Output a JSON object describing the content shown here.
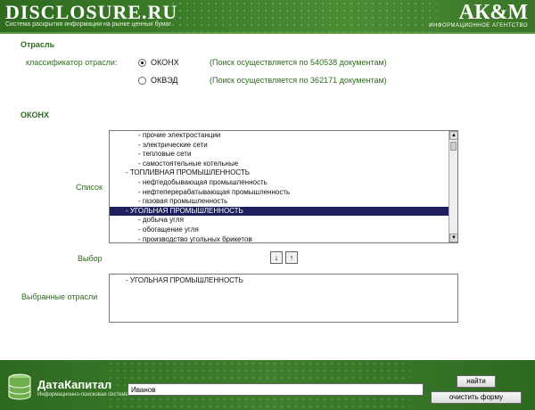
{
  "header": {
    "site_title": "DISCLOSURE.RU",
    "site_subtitle": "Система раскрытия информации на рынке ценных бумаг",
    "brand": "АК&М",
    "brand_subtitle": "ИНФОРМАЦИОННОЕ АГЕНТСТВО"
  },
  "section_industry": "Отрасль",
  "classifier": {
    "label": "классификатор отрасли:",
    "options": [
      {
        "label": "ОКОНХ",
        "checked": true,
        "note": "(Поиск осуществляется по 540538 документам)"
      },
      {
        "label": "ОКВЭД",
        "checked": false,
        "note": "(Поиск осуществляется по 362171 документам)"
      }
    ]
  },
  "section_okonh": "ОКОНХ",
  "list": {
    "label": "Список",
    "items": [
      "- прочие электростанции",
      "- электрические сети",
      "- тепловые сети",
      "- самостоятельные котельные",
      "- ТОПЛИВНАЯ ПРОМЫШЛЕННОСТЬ",
      "- нефтедобывающая промышленность",
      "- нефтеперерабатывающая промышленность",
      "- газовая промышленность",
      "- УГОЛЬНАЯ ПРОМЫШЛЕННОСТЬ",
      "- добыча угля",
      "- обогащение угля",
      "- производство угольных брикетов"
    ],
    "selected_index": 8
  },
  "choice": {
    "label": "Выбор",
    "down_arrow": "↓",
    "up_arrow": "↑"
  },
  "selected_industries": {
    "label": "Выбранные отрасли",
    "value": "- УГОЛЬНАЯ ПРОМЫШЛЕННОСТЬ"
  },
  "footer": {
    "logo_name": "ДатаКапитал",
    "logo_subtitle": "Информационно-поисковая система",
    "search_value": "Иванов",
    "find_button": "найти",
    "clear_button": "очистить форму"
  },
  "colors": {
    "brand_green": "#3c7d29",
    "label_green": "#2f6a1f",
    "selection": "#1e1f5c"
  }
}
